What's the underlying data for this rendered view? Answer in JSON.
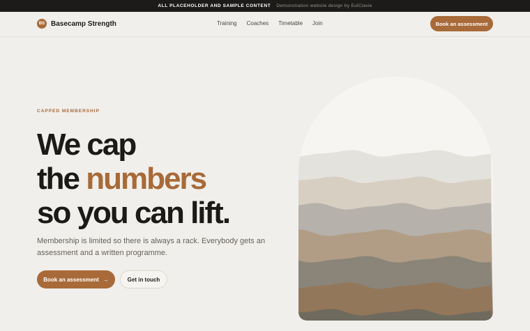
{
  "banner": {
    "notice": "ALL PLACEHOLDER AND SAMPLE CONTENT",
    "credit": "Demonstration website design by EulClavie"
  },
  "nav": {
    "logo_initials": "BS",
    "brand": "Basecamp Strength",
    "links": [
      "Training",
      "Coaches",
      "Timetable",
      "Join"
    ],
    "cta": "Book an assessment"
  },
  "hero": {
    "eyebrow": "CAPPED MEMBERSHIP",
    "headline_line1": "We cap",
    "headline_line2_start": "the ",
    "headline_line2_accent": "numbers",
    "headline_line3": "so you can lift.",
    "lede": "Membership is limited so there is always a rack. Everybody gets an assessment and a written programme.",
    "primary_button": "Book an assessment",
    "primary_button_icon": "→",
    "secondary_button": "Get in touch"
  },
  "colors": {
    "accent": "#a86a38",
    "background": "#f1efeb",
    "dark": "#1c1b19",
    "bands": [
      "#f7f5f1",
      "#e4e2dd",
      "#d7cfc2",
      "#b6b1aa",
      "#b19d86",
      "#8b8478",
      "#93775a",
      "#6f6a5e"
    ]
  }
}
